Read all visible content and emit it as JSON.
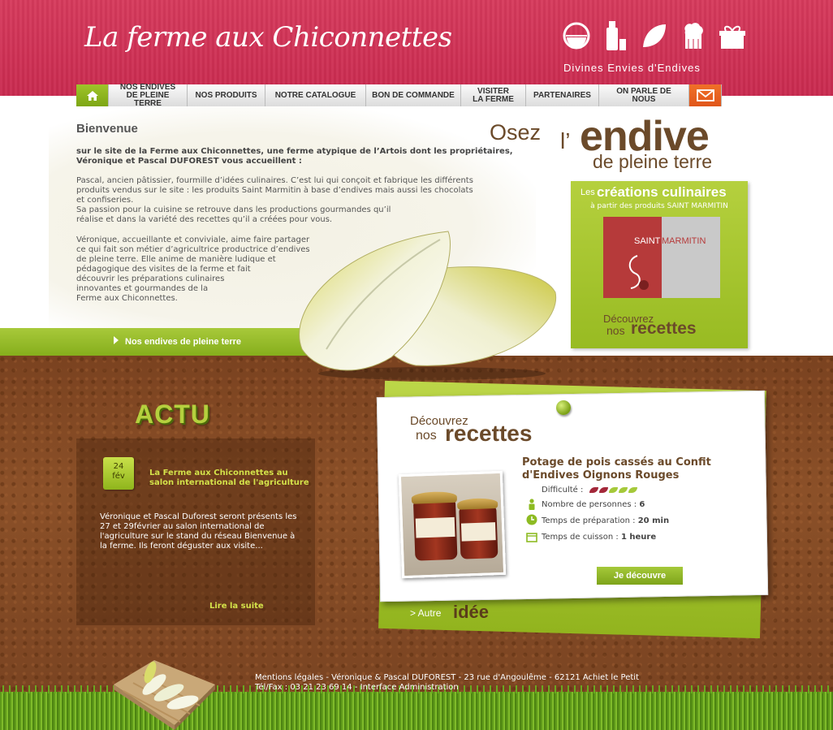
{
  "header": {
    "logo": "La ferme aux Chiconnettes",
    "tagline": "Divines Envies d'Endives",
    "icons": [
      "bowl-icon",
      "bottle-icon",
      "leaf-icon",
      "chef-hat-icon",
      "gift-icon"
    ]
  },
  "nav": {
    "home_icon": "home-icon",
    "items": [
      {
        "label": "NOS ENDIVES\nDE PLEINE TERRE"
      },
      {
        "label": "NOS PRODUITS"
      },
      {
        "label": "NOTRE CATALOGUE"
      },
      {
        "label": "BON DE COMMANDE"
      },
      {
        "label": "VISITER\nLA FERME"
      },
      {
        "label": "PARTENAIRES"
      },
      {
        "label": "ON PARLE DE NOUS"
      }
    ],
    "mail_icon": "mail-icon"
  },
  "welcome": {
    "title": "Bienvenue",
    "intro": "sur le site de la Ferme aux Chiconnettes, une ferme atypique de l’Artois dont les propriétaires, Véronique et Pascal DUFOREST vous accueillent :",
    "p1_lines": [
      "Pascal, ancien pâtissier, fourmille d’idées culinaires. C’est lui qui conçoit et fabrique les différents",
      "produits vendus sur le site : les produits Saint Marmitin à base d’endives mais aussi les chocolats",
      "et confiseries.",
      "Sa passion pour la cuisine se retrouve dans les productions gourmandes qu’il",
      "réalise et dans la variété des recettes qu’il a créées pour vous."
    ],
    "p2_lines": [
      "Véronique, accueillante et conviviale, aime faire partager",
      "ce qui fait son métier d’agricultrice productrice d’endives",
      "de pleine terre. Elle anime de manière ludique et",
      "pédagogique des visites de la ferme et fait",
      "découvrir les préparations culinaires",
      "innovantes et gourmandes de la",
      "Ferme aux Chiconnettes."
    ],
    "band_link": "Nos endives de pleine terre"
  },
  "slogan": {
    "osez": "Osez",
    "l": "l’",
    "endive": "endive",
    "sub": "de pleine terre"
  },
  "creations": {
    "les": "Les",
    "title": "créations culinaires",
    "sub": "à partir des produits SAINT MARMITIN",
    "brand_left": "SAINT",
    "brand_right": "MARMITIN",
    "decouvrez": "Découvrez",
    "nos": "nos",
    "recettes": "recettes"
  },
  "actu": {
    "title": "ACTU",
    "day": "24",
    "month": "fév",
    "headline": "La Ferme aux Chiconnettes au salon international de l'agriculture",
    "body": "Véronique et Pascal Duforest seront présents les 27 et 29février au salon international de l'agriculture sur le stand du réseau Bienvenue à la ferme. Ils feront déguster aux visite...",
    "more": "Lire la suite"
  },
  "recipe": {
    "decouvrez": "Découvrez",
    "nos": "nos",
    "recettes": "recettes",
    "title": "Potage de pois cassés au Confit d'Endives Oignons Rouges",
    "difficulty_label": "Difficulté :",
    "difficulty_level": 2,
    "difficulty_max": 5,
    "persons_label": "Nombre de personnes :",
    "persons_value": "6",
    "prep_label": "Temps de préparation :",
    "prep_value": "20 min",
    "cook_label": "Temps de cuisson :",
    "cook_value": "1 heure",
    "button": "Je découvre",
    "autre": "> Autre",
    "idee": "idée"
  },
  "footer": {
    "legal": "Mentions légales",
    "address": " - Véronique & Pascal DUFOREST - 23 rue d'Angoulême - 62121 Achiet le Petit",
    "tel": "Tél/Fax : 03 21 23 69 14",
    "admin": "Interface Administration"
  },
  "colors": {
    "header_red": "#c92a4f",
    "accent_green": "#98bb22",
    "brown_text": "#6b4a2a",
    "mail_orange": "#e0561a"
  }
}
